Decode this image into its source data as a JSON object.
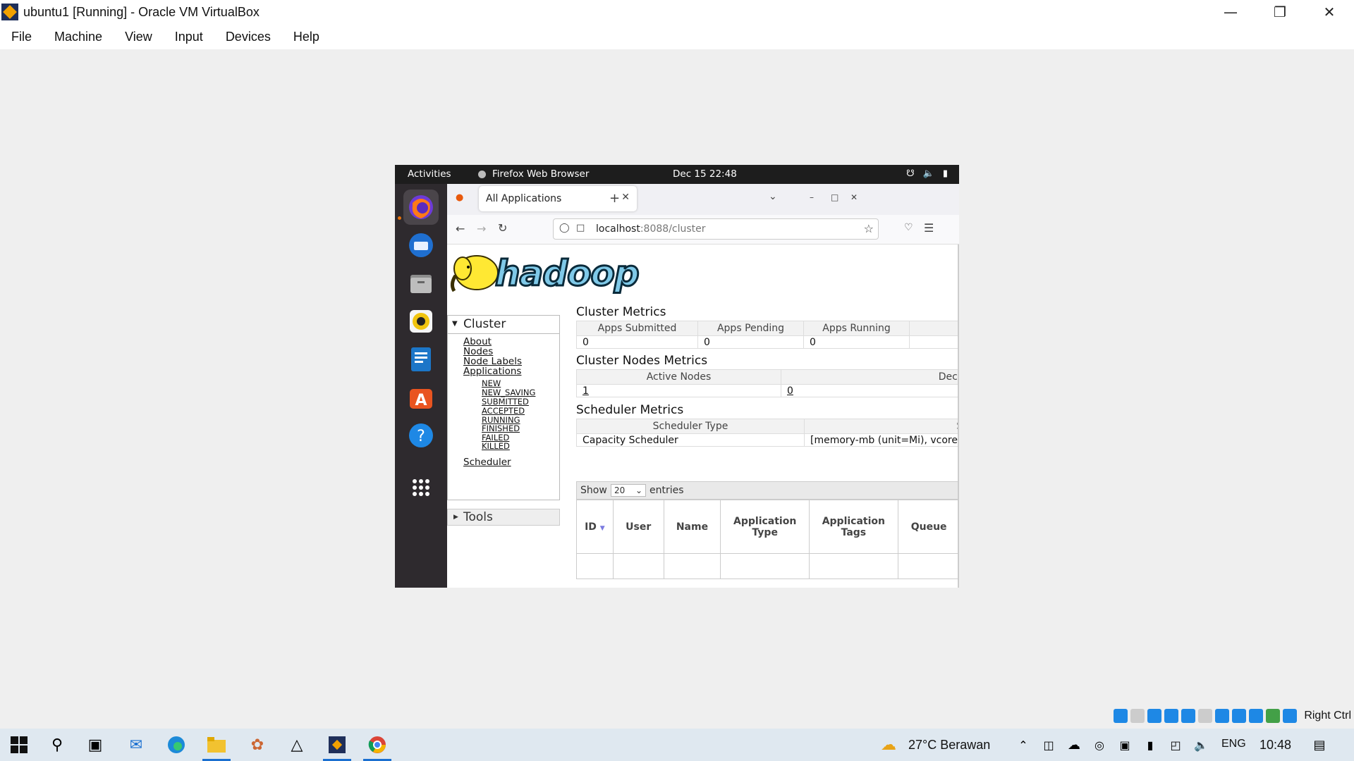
{
  "host": {
    "window_title": "ubuntu1 [Running] - Oracle VM VirtualBox",
    "menu": [
      "File",
      "Machine",
      "View",
      "Input",
      "Devices",
      "Help"
    ],
    "status_right": "Right Ctrl"
  },
  "guest": {
    "topbar": {
      "activities": "Activities",
      "app": "Firefox Web Browser",
      "clock": "Dec 15  22:48"
    },
    "browser": {
      "tab_title": "All Applications",
      "url_host": "localhost",
      "url_rest": ":8088/cluster"
    },
    "page": {
      "logo_text": "hadoop",
      "cluster_head": "Cluster",
      "nav_links": [
        "About",
        "Nodes",
        "Node Labels",
        "Applications"
      ],
      "app_states": [
        "NEW",
        "NEW_SAVING",
        "SUBMITTED",
        "ACCEPTED",
        "RUNNING",
        "FINISHED",
        "FAILED",
        "KILLED"
      ],
      "scheduler_link": "Scheduler",
      "tools_head": "Tools",
      "cluster_metrics": {
        "title": "Cluster Metrics",
        "headers": [
          "Apps Submitted",
          "Apps Pending",
          "Apps Running"
        ],
        "values": [
          "0",
          "0",
          "0"
        ]
      },
      "nodes_metrics": {
        "title": "Cluster Nodes Metrics",
        "headers": [
          "Active Nodes",
          "Decommissi"
        ],
        "values": [
          "1",
          "0"
        ]
      },
      "scheduler_metrics": {
        "title": "Scheduler Metrics",
        "headers": [
          "Scheduler Type",
          "Scheduli"
        ],
        "values": [
          "Capacity Scheduler",
          "[memory-mb (unit=Mi), vcore"
        ]
      },
      "show_label": "Show",
      "show_value": "20",
      "entries_label": "entries",
      "apps_table_headers": [
        "ID",
        "User",
        "Name",
        "Application Type",
        "Application Tags",
        "Queue"
      ]
    }
  },
  "taskbar": {
    "weather": "27°C  Berawan",
    "lang": "ENG",
    "time": "10:48"
  }
}
